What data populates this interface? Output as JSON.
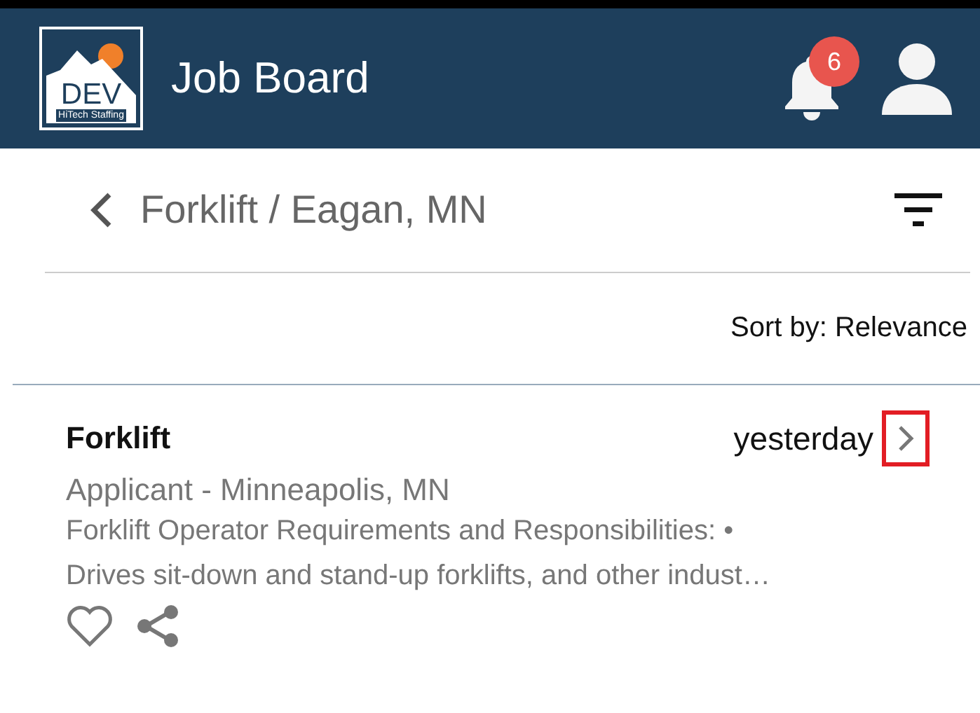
{
  "header": {
    "logo": {
      "main": "DEV",
      "sub": "HiTech Staffing"
    },
    "title": "Job Board",
    "notifications": {
      "count": "6"
    }
  },
  "search": {
    "query": "Forklift / Eagan, MN"
  },
  "sort": {
    "label": "Sort by: Relevance"
  },
  "jobs": [
    {
      "title": "Forklift",
      "posted": "yesterday",
      "subtitle": "Applicant - Minneapolis, MN",
      "description": "Forklift Operator Requirements and Responsibilities: •\nDrives sit-down and stand-up forklifts, and other indust…",
      "favorite": false,
      "highlighted": true
    }
  ]
}
